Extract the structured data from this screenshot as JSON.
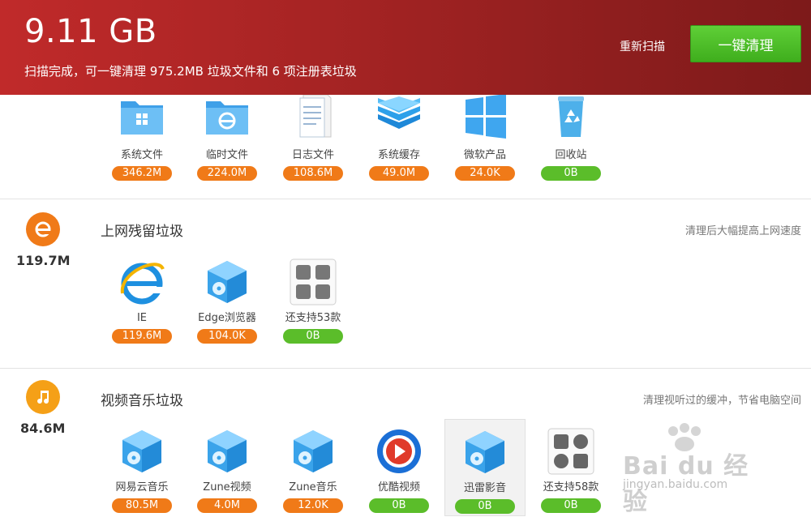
{
  "header": {
    "total_size": "9.11 GB",
    "summary": "扫描完成，可一键清理 975.2MB 垃圾文件和 6 项注册表垃圾",
    "rescan_label": "重新扫描",
    "clean_label": "一键清理"
  },
  "system": {
    "items": [
      {
        "label": "系统文件",
        "size": "346.2M",
        "icon": "folder-windows-icon",
        "status": "orange"
      },
      {
        "label": "临时文件",
        "size": "224.0M",
        "icon": "folder-ie-icon",
        "status": "orange"
      },
      {
        "label": "日志文件",
        "size": "108.6M",
        "icon": "notepad-icon",
        "status": "orange"
      },
      {
        "label": "系统缓存",
        "size": "49.0M",
        "icon": "layers-icon",
        "status": "orange"
      },
      {
        "label": "微软产品",
        "size": "24.0K",
        "icon": "windows-logo-icon",
        "status": "orange"
      },
      {
        "label": "回收站",
        "size": "0B",
        "icon": "recycle-bin-icon",
        "status": "green"
      }
    ]
  },
  "web": {
    "title": "上网残留垃圾",
    "total": "119.7M",
    "hint": "清理后大幅提高上网速度",
    "items": [
      {
        "label": "IE",
        "size": "119.6M",
        "icon": "ie-icon",
        "status": "orange"
      },
      {
        "label": "Edge浏览器",
        "size": "104.0K",
        "icon": "cube-disc-icon",
        "status": "orange"
      },
      {
        "label": "还支持53款",
        "size": "0B",
        "icon": "more-browsers-icon",
        "status": "green"
      }
    ]
  },
  "media": {
    "title": "视频音乐垃圾",
    "total": "84.6M",
    "hint": "清理视听过的缓冲，节省电脑空间",
    "items": [
      {
        "label": "网易云音乐",
        "size": "80.5M",
        "icon": "cube-disc-icon",
        "status": "orange"
      },
      {
        "label": "Zune视频",
        "size": "4.0M",
        "icon": "cube-disc-icon",
        "status": "orange"
      },
      {
        "label": "Zune音乐",
        "size": "12.0K",
        "icon": "cube-disc-icon",
        "status": "orange"
      },
      {
        "label": "优酷视频",
        "size": "0B",
        "icon": "youku-icon",
        "status": "green"
      },
      {
        "label": "迅雷影音",
        "size": "0B",
        "icon": "cube-disc-icon",
        "status": "green"
      },
      {
        "label": "还支持58款",
        "size": "0B",
        "icon": "more-players-icon",
        "status": "green"
      }
    ]
  },
  "watermark": {
    "text": "Bai du 经验",
    "url": "jingyan.baidu.com"
  },
  "colors": {
    "header_start": "#c02a2a",
    "header_end": "#7d1a1a",
    "accent_green": "#5bbd2a",
    "accent_orange": "#f07a18"
  }
}
